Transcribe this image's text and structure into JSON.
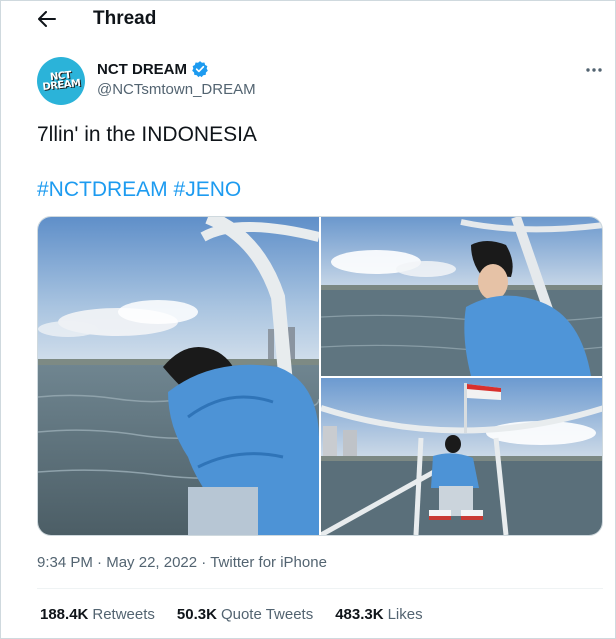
{
  "header": {
    "title": "Thread"
  },
  "author": {
    "name": "NCT DREAM",
    "handle": "@NCTsmtown_DREAM",
    "avatar_text": "NCT DREAM",
    "verified": true
  },
  "tweet": {
    "text": "7llin' in the INDONESIA",
    "hashtags": [
      "#NCTDREAM",
      "#JENO"
    ]
  },
  "meta": {
    "time": "9:34 PM",
    "date": "May 22, 2022",
    "source": "Twitter for iPhone",
    "separator": "·"
  },
  "stats": [
    {
      "count": "188.4K",
      "label": "Retweets"
    },
    {
      "count": "50.3K",
      "label": "Quote Tweets"
    },
    {
      "count": "483.3K",
      "label": "Likes"
    }
  ],
  "colors": {
    "accent": "#1d9bf0",
    "secondary_text": "#536471",
    "avatar_bg": "#2bb3d9"
  },
  "icons": {
    "back": "arrow-left-icon",
    "verified": "verified-badge-icon",
    "more": "more-horizontal-icon"
  }
}
